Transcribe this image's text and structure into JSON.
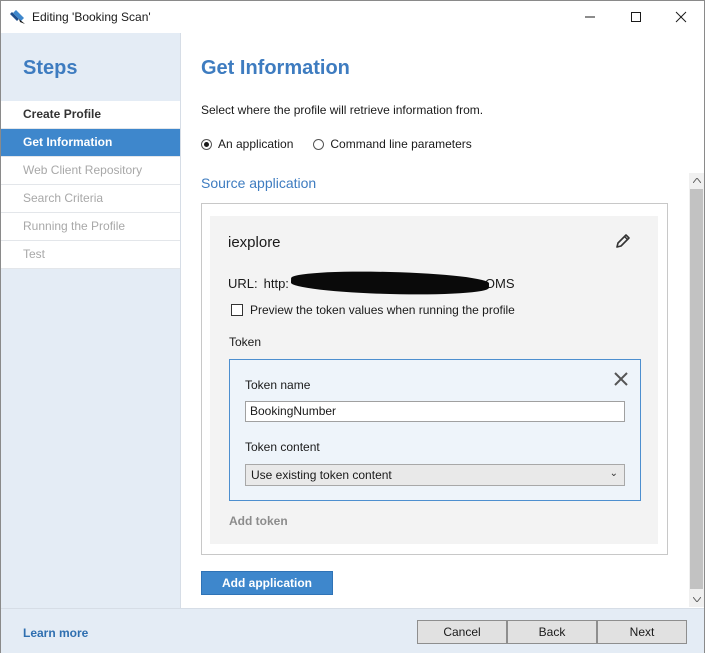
{
  "window": {
    "title": "Editing 'Booking Scan'"
  },
  "steps": {
    "heading": "Steps",
    "items": [
      {
        "label": "Create Profile",
        "state": "done"
      },
      {
        "label": "Get Information",
        "state": "active"
      },
      {
        "label": "Web Client Repository",
        "state": "future"
      },
      {
        "label": "Search Criteria",
        "state": "future"
      },
      {
        "label": "Running the Profile",
        "state": "future"
      },
      {
        "label": "Test",
        "state": "future"
      }
    ]
  },
  "main": {
    "title": "Get Information",
    "instructions": "Select where the profile will retrieve information from.",
    "source_options": [
      {
        "label": "An application",
        "selected": true
      },
      {
        "label": "Command line parameters",
        "selected": false
      }
    ],
    "section_title": "Source application",
    "application": {
      "name": "iexplore",
      "url_label": "URL:",
      "url_prefix": "http:",
      "url_suffix": "OMS",
      "preview_label": "Preview the token values when running the profile",
      "preview_checked": false,
      "token_heading": "Token",
      "token": {
        "name_label": "Token name",
        "name_value": "BookingNumber",
        "content_label": "Token content",
        "content_value": "Use existing token content"
      },
      "add_token_label": "Add token"
    },
    "add_application_label": "Add application"
  },
  "footer": {
    "learn_more": "Learn more",
    "cancel": "Cancel",
    "back": "Back",
    "next": "Next"
  },
  "colors": {
    "accent": "#3e7cc0",
    "active_step": "#3e87cc",
    "panel": "#e4ecf5"
  }
}
